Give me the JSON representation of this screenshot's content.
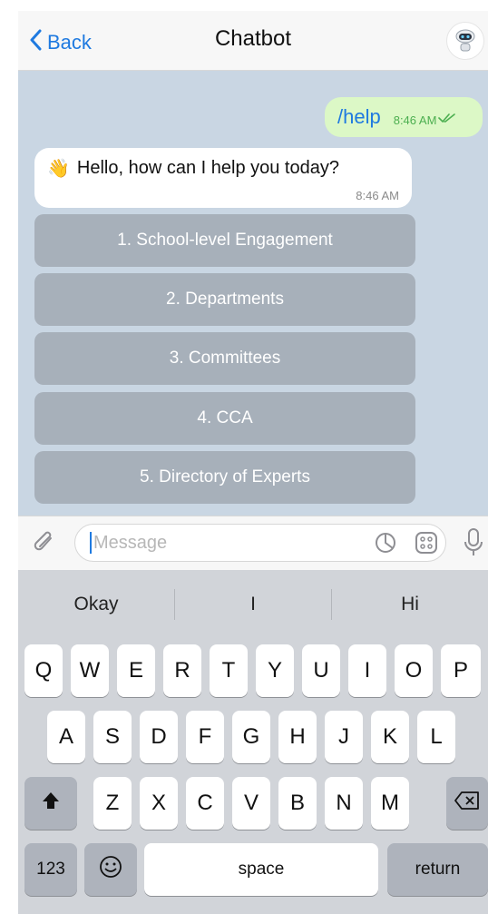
{
  "header": {
    "back_label": "Back",
    "title": "Chatbot"
  },
  "chat": {
    "outgoing": {
      "text": "/help",
      "time": "8:46 AM"
    },
    "incoming": {
      "emoji": "👋",
      "text": "Hello, how can I help you today?",
      "time": "8:46 AM"
    },
    "commands": [
      "1. School-level Engagement",
      "2. Departments",
      "3. Committees",
      "4. CCA",
      "5. Directory of Experts"
    ]
  },
  "input": {
    "placeholder": "Message"
  },
  "keyboard": {
    "suggestions": [
      "Okay",
      "I",
      "Hi"
    ],
    "row1": [
      "Q",
      "W",
      "E",
      "R",
      "T",
      "Y",
      "U",
      "I",
      "O",
      "P"
    ],
    "row2": [
      "A",
      "S",
      "D",
      "F",
      "G",
      "H",
      "J",
      "K",
      "L"
    ],
    "row3": [
      "Z",
      "X",
      "C",
      "V",
      "B",
      "N",
      "M"
    ],
    "numbers_label": "123",
    "space_label": "space",
    "return_label": "return"
  },
  "colors": {
    "accent": "#1f7ae0",
    "chat_bg": "#c9d6e3",
    "outgoing_bubble": "#dcf8c6",
    "command_button": "#a7b0ba"
  },
  "icons": [
    "chevron-left-icon",
    "bot-avatar-icon",
    "double-check-icon",
    "waving-hand-emoji",
    "paperclip-icon",
    "sticker-icon",
    "emoji-grid-icon",
    "microphone-icon",
    "shift-icon",
    "backspace-icon",
    "emoji-face-icon"
  ]
}
